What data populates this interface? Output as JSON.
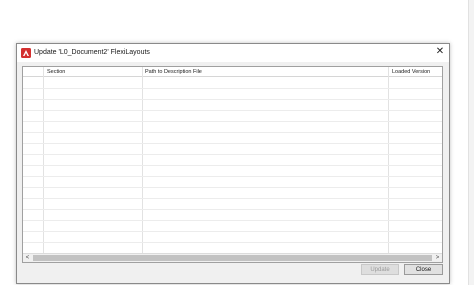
{
  "dialog": {
    "title": "Update 'L0_Document2' FlexiLayouts",
    "close_glyph": "✕",
    "app_icon": "app-logo-icon",
    "brand_color": "#d32f2f"
  },
  "grid": {
    "columns": [
      "Section",
      "Path to Description File",
      "Loaded Version"
    ],
    "rows": []
  },
  "scrollbar": {
    "left_arrow": "<",
    "right_arrow": ">"
  },
  "buttons": {
    "update_label": "Update",
    "update_enabled": false,
    "close_label": "Close"
  }
}
